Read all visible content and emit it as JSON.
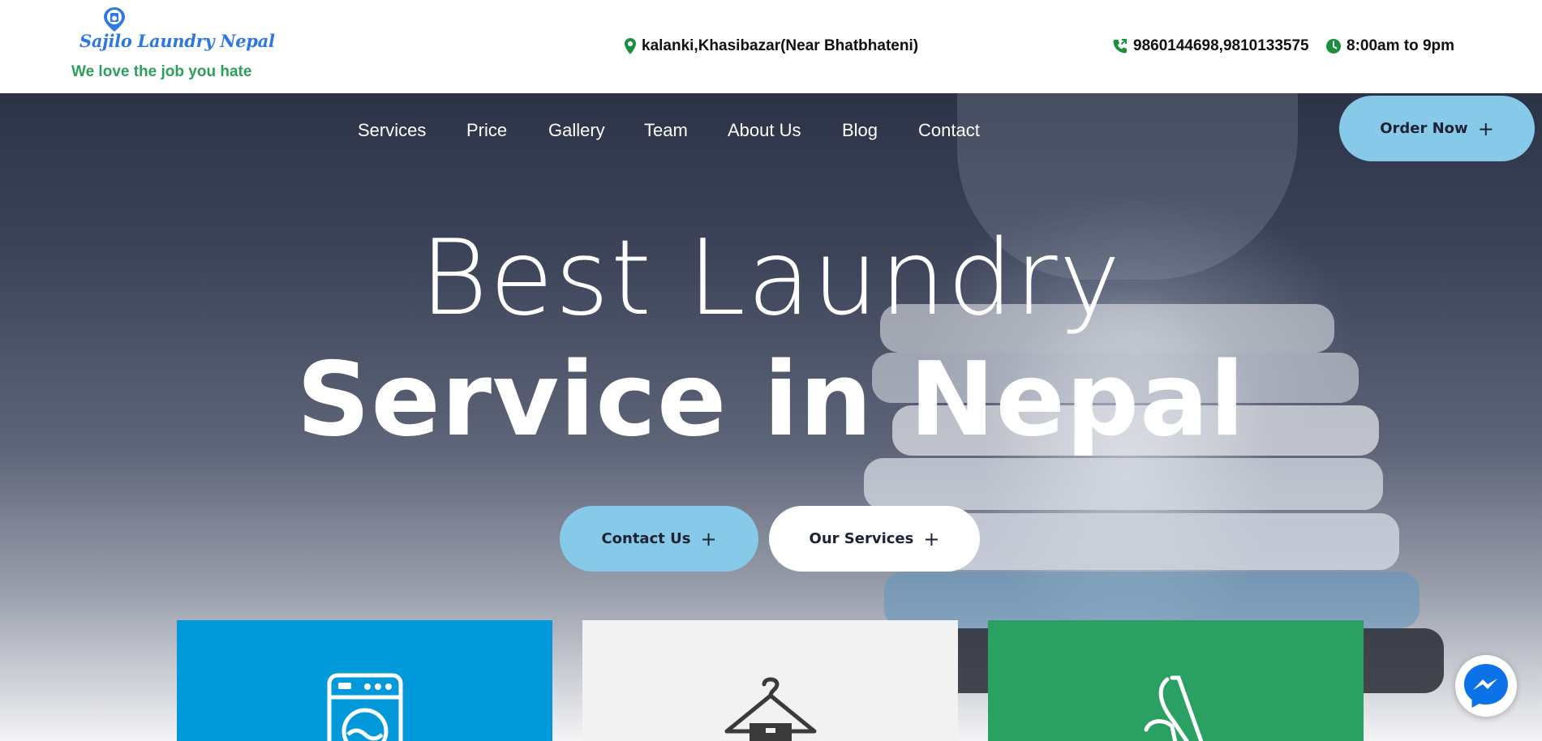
{
  "header": {
    "logo_text": "Sajilo Laundry Nepal",
    "tagline": "We love the job you hate",
    "address": "kalanki,Khasibazar(Near Bhatbhateni)",
    "phone": "9860144698,9810133575",
    "hours": "8:00am to 9pm",
    "icons": [
      "map-pin-icon",
      "phone-icon",
      "clock-icon"
    ]
  },
  "nav": {
    "items": [
      "Services",
      "Price",
      "Gallery",
      "Team",
      "About Us",
      "Blog",
      "Contact"
    ],
    "order_button": "Order Now"
  },
  "hero": {
    "line1": "Best Laundry",
    "line2": "Service in Nepal",
    "contact_button": "Contact Us",
    "services_button": "Our Services"
  },
  "cards": [
    {
      "icon": "washing-machine-icon",
      "color": "#0299db"
    },
    {
      "icon": "hanger-icon",
      "color": "#f2f2f2"
    },
    {
      "icon": "iron-icon",
      "color": "#2aa162"
    }
  ],
  "colors": {
    "accent_blue": "#87c9e9",
    "brand_blue": "#2f78e0",
    "tagline_green": "#2e9e5b",
    "icon_green": "#1a8f3c",
    "messenger": "#0b72e7"
  }
}
